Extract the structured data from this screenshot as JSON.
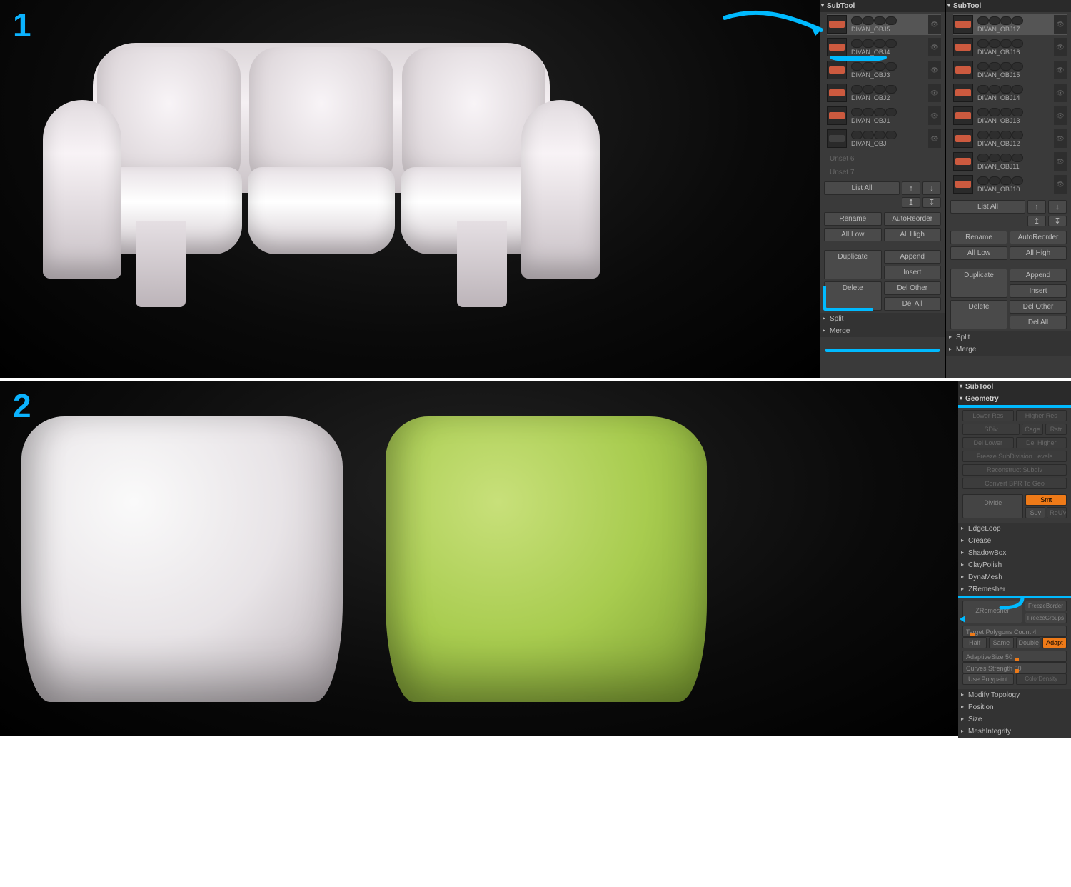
{
  "step1": {
    "number": "1",
    "panel_title": "SubTool",
    "col1": {
      "items": [
        {
          "name": "DIVAN_OBJ5",
          "color": "#cc5a3f",
          "sel": true
        },
        {
          "name": "DIVAN_OBJ4",
          "color": "#cc5a3f"
        },
        {
          "name": "DIVAN_OBJ3",
          "color": "#cc5a3f"
        },
        {
          "name": "DIVAN_OBJ2",
          "color": "#cc5a3f"
        },
        {
          "name": "DIVAN_OBJ1",
          "color": "#cc5a3f"
        },
        {
          "name": "DIVAN_OBJ",
          "color": "#404040"
        }
      ],
      "empty1": "Unset 6",
      "empty2": "Unset 7"
    },
    "col2": {
      "items": [
        {
          "name": "DIVAN_OBJ17",
          "color": "#cc5a3f",
          "sel": true
        },
        {
          "name": "DIVAN_OBJ16",
          "color": "#cc5a3f"
        },
        {
          "name": "DIVAN_OBJ15",
          "color": "#cc5a3f"
        },
        {
          "name": "DIVAN_OBJ14",
          "color": "#cc5a3f"
        },
        {
          "name": "DIVAN_OBJ13",
          "color": "#cc5a3f"
        },
        {
          "name": "DIVAN_OBJ12",
          "color": "#cc5a3f"
        },
        {
          "name": "DIVAN_OBJ11",
          "color": "#cc5a3f"
        },
        {
          "name": "DIVAN_OBJ10",
          "color": "#cc5a3f"
        }
      ]
    },
    "buttons": {
      "list_all": "List All",
      "rename": "Rename",
      "auto_reorder": "AutoReorder",
      "all_low": "All Low",
      "all_high": "All High",
      "duplicate": "Duplicate",
      "append": "Append",
      "insert": "Insert",
      "delete": "Delete",
      "del_other": "Del Other",
      "del_all": "Del All",
      "split": "Split",
      "merge": "Merge"
    }
  },
  "step2": {
    "number": "2",
    "panel_subtool": "SubTool",
    "panel_geometry": "Geometry",
    "geo": {
      "lower_res": "Lower Res",
      "higher_res": "Higher Res",
      "sdiv": "SDiv",
      "cage": "Cage",
      "rstr": "Rstr",
      "del_lower": "Del Lower",
      "del_higher": "Del Higher",
      "freeze_sub": "Freeze SubDivision Levels",
      "reconstruct": "Reconstruct Subdiv",
      "convert_bpr": "Convert BPR To Geo",
      "divide": "Divide",
      "smt": "Smt",
      "suv": "Suv",
      "reuv": "ReUV",
      "edgeloop": "EdgeLoop",
      "crease": "Crease",
      "shadowbox": "ShadowBox",
      "claypolish": "ClayPolish",
      "dynamesh": "DynaMesh",
      "zremesher": "ZRemesher",
      "zremesher_btn": "ZRemesher",
      "freeze_border": "FreezeBorder",
      "freeze_groups": "FreezeGroups",
      "target_poly": "Target Polygons Count 4",
      "half": "Half",
      "same": "Same",
      "double": "Double",
      "adapt": "Adapt",
      "adaptive_size": "AdaptiveSize 50",
      "curves_strength": "Curves Strength 50",
      "use_polypaint": "Use Polypaint",
      "color_density": "ColorDensity",
      "modify_topology": "Modify Topology",
      "position": "Position",
      "size": "Size",
      "mesh_integrity": "MeshIntegrity"
    }
  }
}
